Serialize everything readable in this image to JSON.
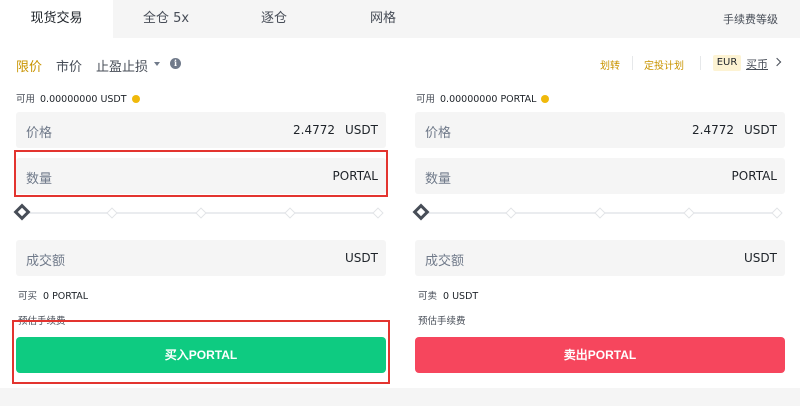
{
  "tabs": [
    {
      "label": "现货交易",
      "active": true
    },
    {
      "label": "全仓 5x",
      "active": false
    },
    {
      "label": "逐仓",
      "active": false
    },
    {
      "label": "网格",
      "active": false
    }
  ],
  "fee_level": "手续费等级",
  "order_types": {
    "limit": "限价",
    "market": "市价",
    "stop_limit": "止盈止损"
  },
  "toolbar": {
    "transfer": "划转",
    "auto_invest": "定投计划",
    "currency": "EUR",
    "buy_fiat": "买币"
  },
  "buy": {
    "available_label": "可用",
    "available_value": "0.00000000 USDT",
    "price_label": "价格",
    "price_value": "2.4772",
    "price_unit": "USDT",
    "amount_label": "数量",
    "amount_unit": "PORTAL",
    "total_label": "成交额",
    "total_unit": "USDT",
    "max_label": "可买",
    "max_value": "0 PORTAL",
    "fee_label": "预估手续费",
    "button": "买入PORTAL",
    "slider_percent": 0
  },
  "sell": {
    "available_label": "可用",
    "available_value": "0.00000000 PORTAL",
    "price_label": "价格",
    "price_value": "2.4772",
    "price_unit": "USDT",
    "amount_label": "数量",
    "amount_unit": "PORTAL",
    "total_label": "成交额",
    "total_unit": "USDT",
    "max_label": "可卖",
    "max_value": "0 USDT",
    "fee_label": "预估手续费",
    "button": "卖出PORTAL",
    "slider_percent": 0
  },
  "colors": {
    "accent": "#c99400",
    "buy": "#0ecb81",
    "sell": "#f6465d",
    "highlight": "#e3342f"
  }
}
